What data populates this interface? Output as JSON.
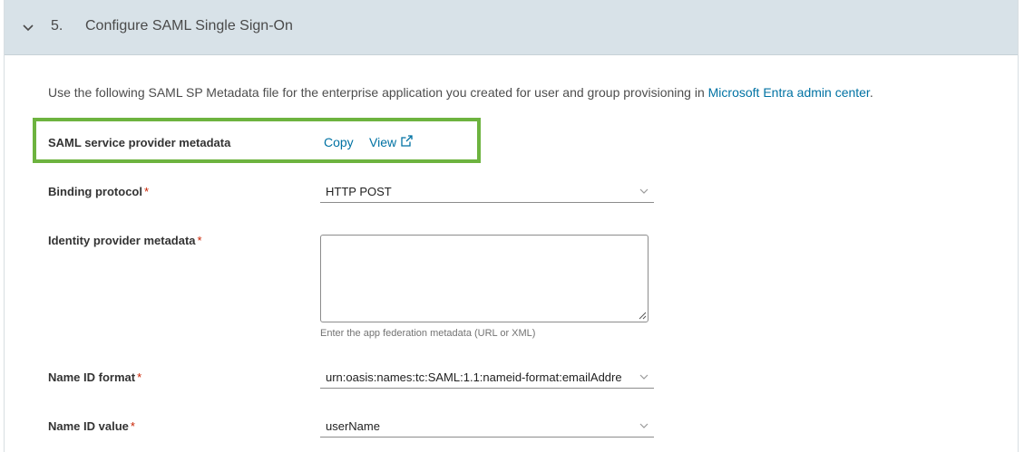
{
  "header": {
    "step": "5.",
    "title": "Configure SAML Single Sign-On",
    "chevron_icon": "chevron-down-icon"
  },
  "intro": {
    "text": "Use the following SAML SP Metadata file for the enterprise application you created for user and group provisioning in ",
    "link": "Microsoft Entra admin center",
    "suffix": "."
  },
  "sp_metadata": {
    "label": "SAML service provider metadata",
    "copy": "Copy",
    "view": "View",
    "view_icon": "external-link-icon",
    "highlight_color": "#6db33f"
  },
  "binding": {
    "label": "Binding protocol",
    "required": "*",
    "value": "HTTP POST"
  },
  "idp_metadata": {
    "label": "Identity provider metadata",
    "required": "*",
    "value": "",
    "helper": "Enter the app federation metadata (URL or XML)"
  },
  "name_id_format": {
    "label": "Name ID format",
    "required": "*",
    "value": "urn:oasis:names:tc:SAML:1.1:nameid-format:emailAddre"
  },
  "name_id_value": {
    "label": "Name ID value",
    "required": "*",
    "value": "userName"
  },
  "colors": {
    "link": "#0072a3",
    "required": "#c92100",
    "header_bg": "#d8e2e8"
  }
}
